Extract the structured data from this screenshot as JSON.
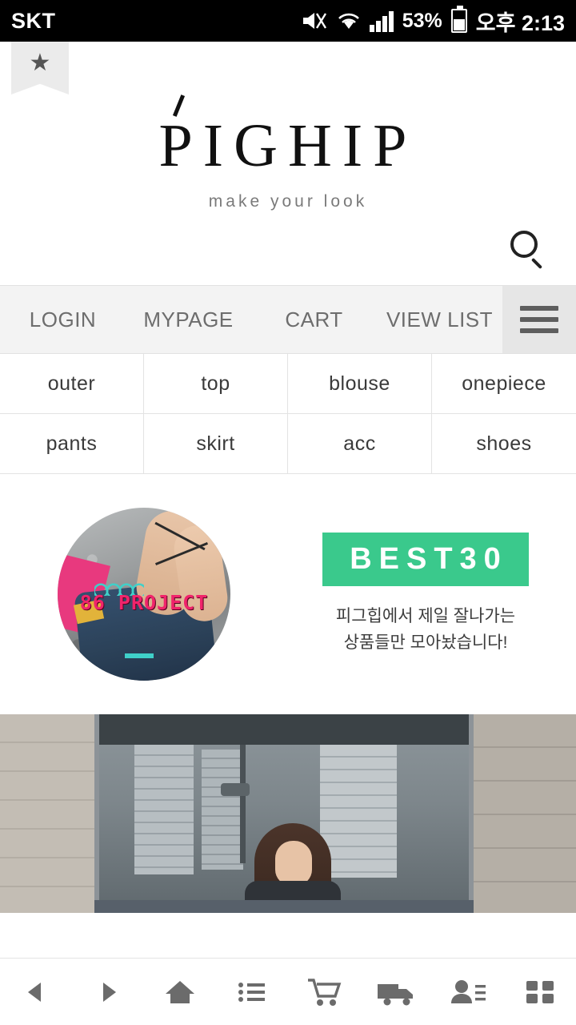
{
  "statusbar": {
    "carrier": "SKT",
    "battery_percent": "53%",
    "clock": "오후 2:13",
    "icons": [
      "mute-icon",
      "wifi-icon",
      "signal-icon",
      "battery-icon"
    ]
  },
  "bookmark": {
    "icon": "star-icon",
    "glyph": "★"
  },
  "brand": {
    "name": "PIGHIP",
    "tagline": "make your look"
  },
  "search": {
    "icon": "search-icon"
  },
  "nav": {
    "items": [
      {
        "label": "LOGIN"
      },
      {
        "label": "MYPAGE"
      },
      {
        "label": "CART"
      },
      {
        "label": "VIEW LIST"
      }
    ],
    "menu_icon": "hamburger-icon"
  },
  "categories": [
    {
      "label": "outer"
    },
    {
      "label": "top"
    },
    {
      "label": "blouse"
    },
    {
      "label": "onepiece"
    },
    {
      "label": "pants"
    },
    {
      "label": "skirt"
    },
    {
      "label": "acc"
    },
    {
      "label": "shoes"
    }
  ],
  "promo": {
    "left": {
      "caption": "86 PROJECT",
      "image_name": "86-project-circle-photo"
    },
    "right": {
      "badge": "BEST30",
      "badge_color": "#3ac98c",
      "desc_line1": "피그힙에서 제일 잘나가는",
      "desc_line2": "상품들만 모아놨습니다!"
    }
  },
  "hero": {
    "image_name": "lookbook-street-photo"
  },
  "bottombar": {
    "items": [
      {
        "icon": "back-arrow-icon"
      },
      {
        "icon": "forward-arrow-icon"
      },
      {
        "icon": "home-icon"
      },
      {
        "icon": "list-icon"
      },
      {
        "icon": "cart-icon"
      },
      {
        "icon": "delivery-truck-icon"
      },
      {
        "icon": "account-icon"
      },
      {
        "icon": "grid-icon"
      }
    ]
  }
}
